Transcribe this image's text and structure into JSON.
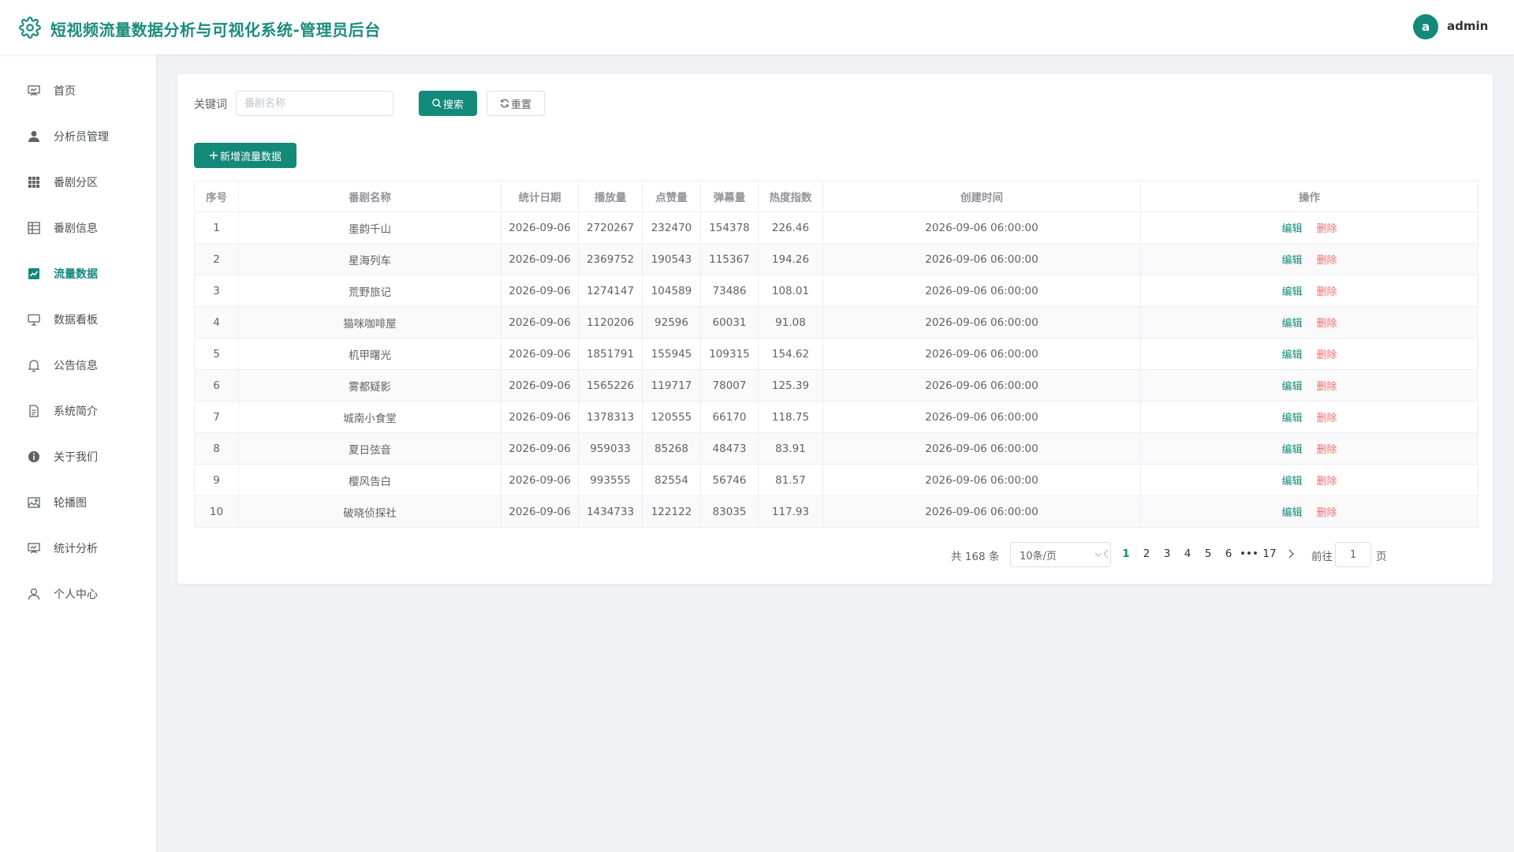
{
  "header": {
    "title": "短视频流量数据分析与可视化系统-管理员后台",
    "avatar_letter": "a",
    "username": "admin",
    "logo_icon": "gear-icon",
    "accent_color": "#13897a"
  },
  "sidebar": {
    "items": [
      {
        "label": "首页",
        "icon": "presentation-icon",
        "active": false
      },
      {
        "label": "分析员管理",
        "icon": "user-icon",
        "active": false
      },
      {
        "label": "番剧分区",
        "icon": "grid-icon",
        "active": false
      },
      {
        "label": "番剧信息",
        "icon": "table-icon",
        "active": false
      },
      {
        "label": "流量数据",
        "icon": "chart-icon",
        "active": true
      },
      {
        "label": "数据看板",
        "icon": "monitor-icon",
        "active": false
      },
      {
        "label": "公告信息",
        "icon": "bell-icon",
        "active": false
      },
      {
        "label": "系统简介",
        "icon": "document-icon",
        "active": false
      },
      {
        "label": "关于我们",
        "icon": "info-icon",
        "active": false
      },
      {
        "label": "轮播图",
        "icon": "picture-icon",
        "active": false
      },
      {
        "label": "统计分析",
        "icon": "presentation-icon",
        "active": false
      },
      {
        "label": "个人中心",
        "icon": "user-outline-icon",
        "active": false
      }
    ]
  },
  "search": {
    "label": "关键词",
    "placeholder": "番剧名称",
    "value": "",
    "search_label": "搜索",
    "reset_label": "重置"
  },
  "toolbar": {
    "add_label": "新增流量数据"
  },
  "table": {
    "headers": [
      "序号",
      "番剧名称",
      "统计日期",
      "播放量",
      "点赞量",
      "弹幕量",
      "热度指数",
      "创建时间",
      "操作"
    ],
    "edit_label": "编辑",
    "delete_label": "删除",
    "rows": [
      [
        "1",
        "墨韵千山",
        "2026-09-06",
        "2720267",
        "232470",
        "154378",
        "226.46",
        "2026-09-06 06:00:00"
      ],
      [
        "2",
        "星海列车",
        "2026-09-06",
        "2369752",
        "190543",
        "115367",
        "194.26",
        "2026-09-06 06:00:00"
      ],
      [
        "3",
        "荒野旅记",
        "2026-09-06",
        "1274147",
        "104589",
        "73486",
        "108.01",
        "2026-09-06 06:00:00"
      ],
      [
        "4",
        "猫咪咖啡屋",
        "2026-09-06",
        "1120206",
        "92596",
        "60031",
        "91.08",
        "2026-09-06 06:00:00"
      ],
      [
        "5",
        "机甲曙光",
        "2026-09-06",
        "1851791",
        "155945",
        "109315",
        "154.62",
        "2026-09-06 06:00:00"
      ],
      [
        "6",
        "雾都疑影",
        "2026-09-06",
        "1565226",
        "119717",
        "78007",
        "125.39",
        "2026-09-06 06:00:00"
      ],
      [
        "7",
        "城南小食堂",
        "2026-09-06",
        "1378313",
        "120555",
        "66170",
        "118.75",
        "2026-09-06 06:00:00"
      ],
      [
        "8",
        "夏日弦音",
        "2026-09-06",
        "959033",
        "85268",
        "48473",
        "83.91",
        "2026-09-06 06:00:00"
      ],
      [
        "9",
        "樱风告白",
        "2026-09-06",
        "993555",
        "82554",
        "56746",
        "81.57",
        "2026-09-06 06:00:00"
      ],
      [
        "10",
        "破晓侦探社",
        "2026-09-06",
        "1434733",
        "122122",
        "83035",
        "117.93",
        "2026-09-06 06:00:00"
      ]
    ]
  },
  "pagination": {
    "total_text": "共 168 条",
    "page_size": "10条/页",
    "pages": [
      "1",
      "2",
      "3",
      "4",
      "5",
      "6",
      "•••",
      "17"
    ],
    "current": "1",
    "goto_label": "前往",
    "goto_value": "1",
    "page_unit": "页"
  }
}
